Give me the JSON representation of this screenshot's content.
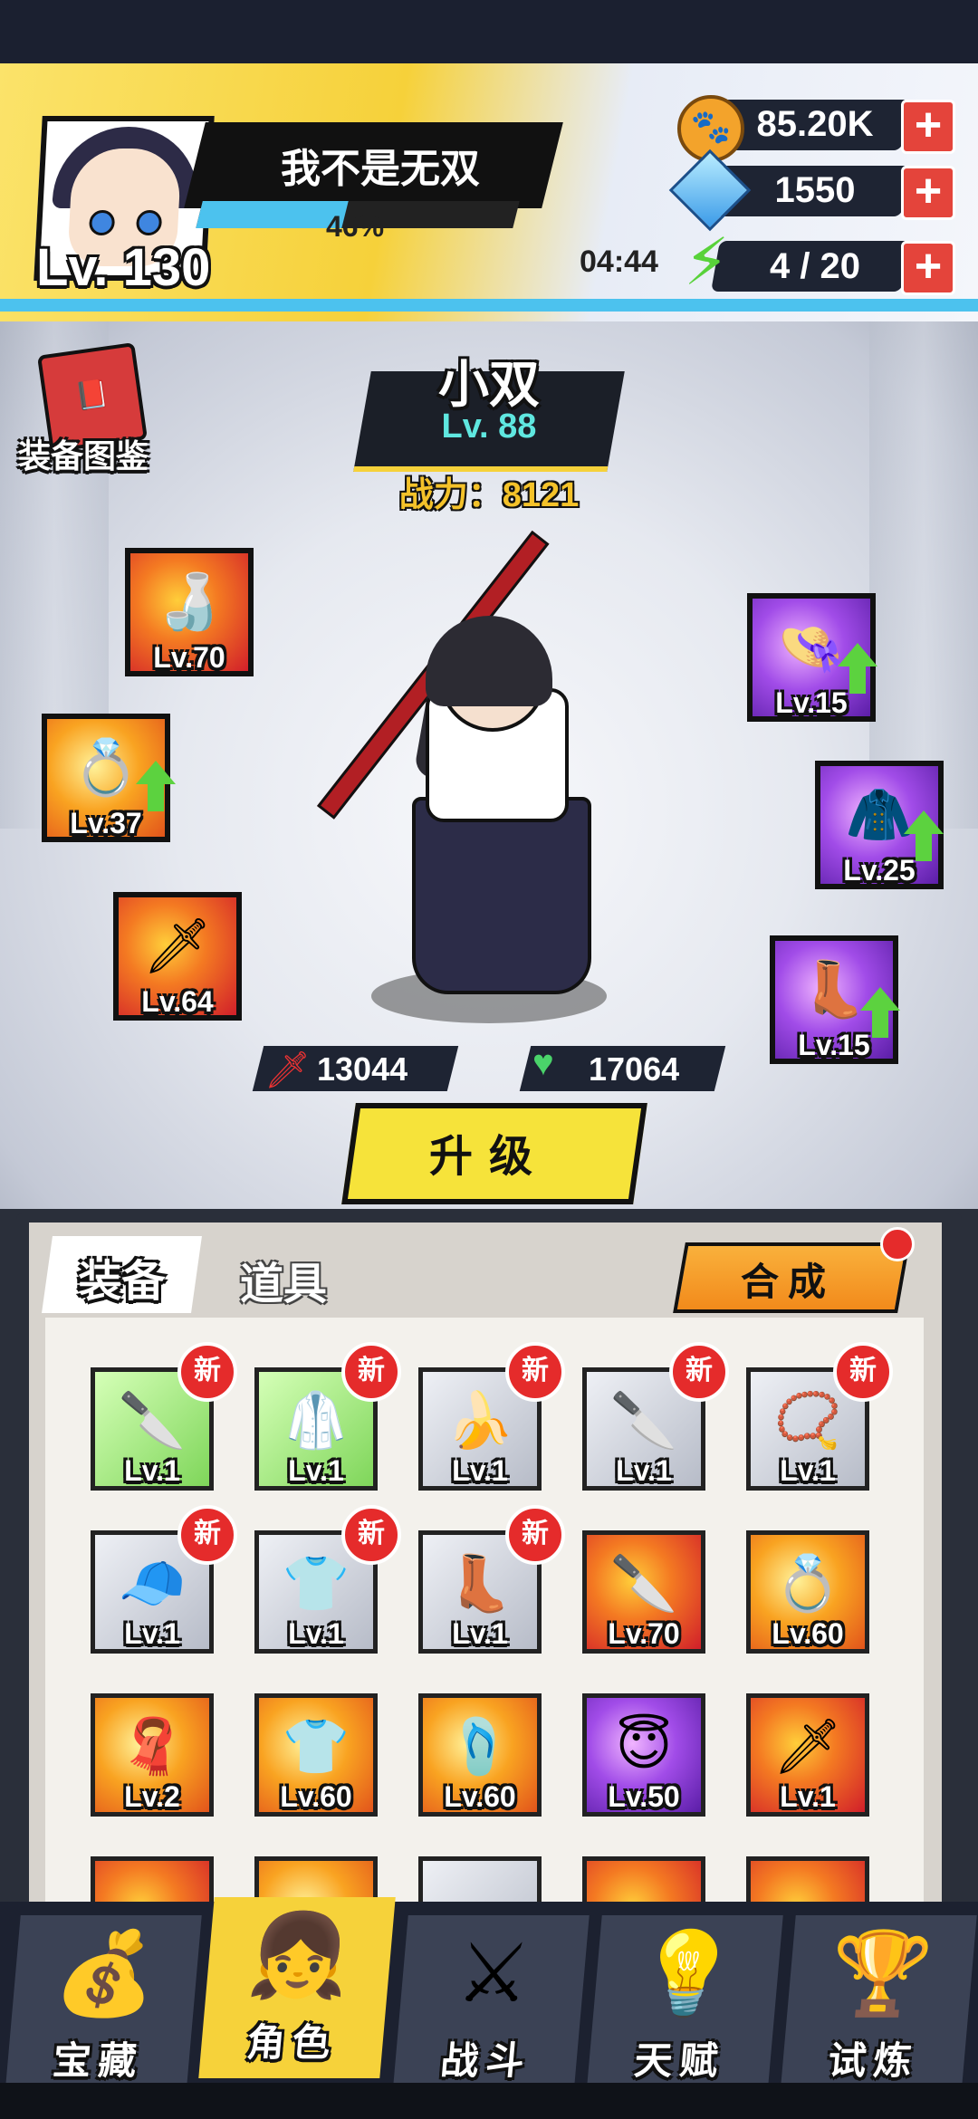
{
  "header": {
    "player_level": "Lv. 130",
    "player_name": "我不是无双",
    "xp_percent_text": "46%",
    "xp_fraction": 0.46,
    "coins": "85.20K",
    "gems": "1550",
    "energy": "4 / 20",
    "energy_timer": "04:44",
    "plus_glyph": "+"
  },
  "stage": {
    "book_label": "装备图鉴",
    "hero_name": "小双",
    "hero_level": "Lv. 88",
    "power": "战力：8121",
    "attack": "13044",
    "hp": "17064",
    "upgrade_label": "升级"
  },
  "equip_slots": [
    {
      "icon": "gourd-icon",
      "level": "Lv.70"
    },
    {
      "icon": "ring-icon",
      "level": "Lv.37"
    },
    {
      "icon": "sword-icon",
      "level": "Lv.64"
    },
    {
      "icon": "helmet-icon",
      "level": "Lv.15"
    },
    {
      "icon": "armor-icon",
      "level": "Lv.25"
    },
    {
      "icon": "boot-icon",
      "level": "Lv.15"
    }
  ],
  "inventory": {
    "tab_equip": "装备",
    "tab_items": "道具",
    "merge_label": "合成",
    "new_badge": "新",
    "items": [
      {
        "level": "Lv.1",
        "icon": "blade-icon",
        "is_new": true
      },
      {
        "level": "Lv.1",
        "icon": "robe-icon",
        "is_new": true
      },
      {
        "level": "Lv.1",
        "icon": "banana-blade-icon",
        "is_new": true
      },
      {
        "level": "Lv.1",
        "icon": "blade-icon",
        "is_new": true
      },
      {
        "level": "Lv.1",
        "icon": "bead-necklace-icon",
        "is_new": true
      },
      {
        "level": "Lv.1",
        "icon": "cap-icon",
        "is_new": true
      },
      {
        "level": "Lv.1",
        "icon": "blue-shirt-icon",
        "is_new": true
      },
      {
        "level": "Lv.1",
        "icon": "boot-icon",
        "is_new": true
      },
      {
        "level": "Lv.70",
        "icon": "blade-icon",
        "is_new": false
      },
      {
        "level": "Lv.60",
        "icon": "ring-icon",
        "is_new": false
      },
      {
        "level": "Lv.2",
        "icon": "scarf-icon",
        "is_new": false
      },
      {
        "level": "Lv.60",
        "icon": "blue-shirt-icon",
        "is_new": false
      },
      {
        "level": "Lv.60",
        "icon": "slipper-icon",
        "is_new": false
      },
      {
        "level": "Lv.50",
        "icon": "halo-icon",
        "is_new": false
      },
      {
        "level": "Lv.1",
        "icon": "cursed-blade-icon",
        "is_new": false
      }
    ]
  },
  "nav": [
    {
      "label": "宝藏",
      "icon": "chest-icon",
      "active": false
    },
    {
      "label": "角色",
      "icon": "character-icon",
      "active": true
    },
    {
      "label": "战斗",
      "icon": "swords-icon",
      "active": false
    },
    {
      "label": "天赋",
      "icon": "bulb-icon",
      "active": false
    },
    {
      "label": "试炼",
      "icon": "trophy-icon",
      "active": false
    }
  ]
}
